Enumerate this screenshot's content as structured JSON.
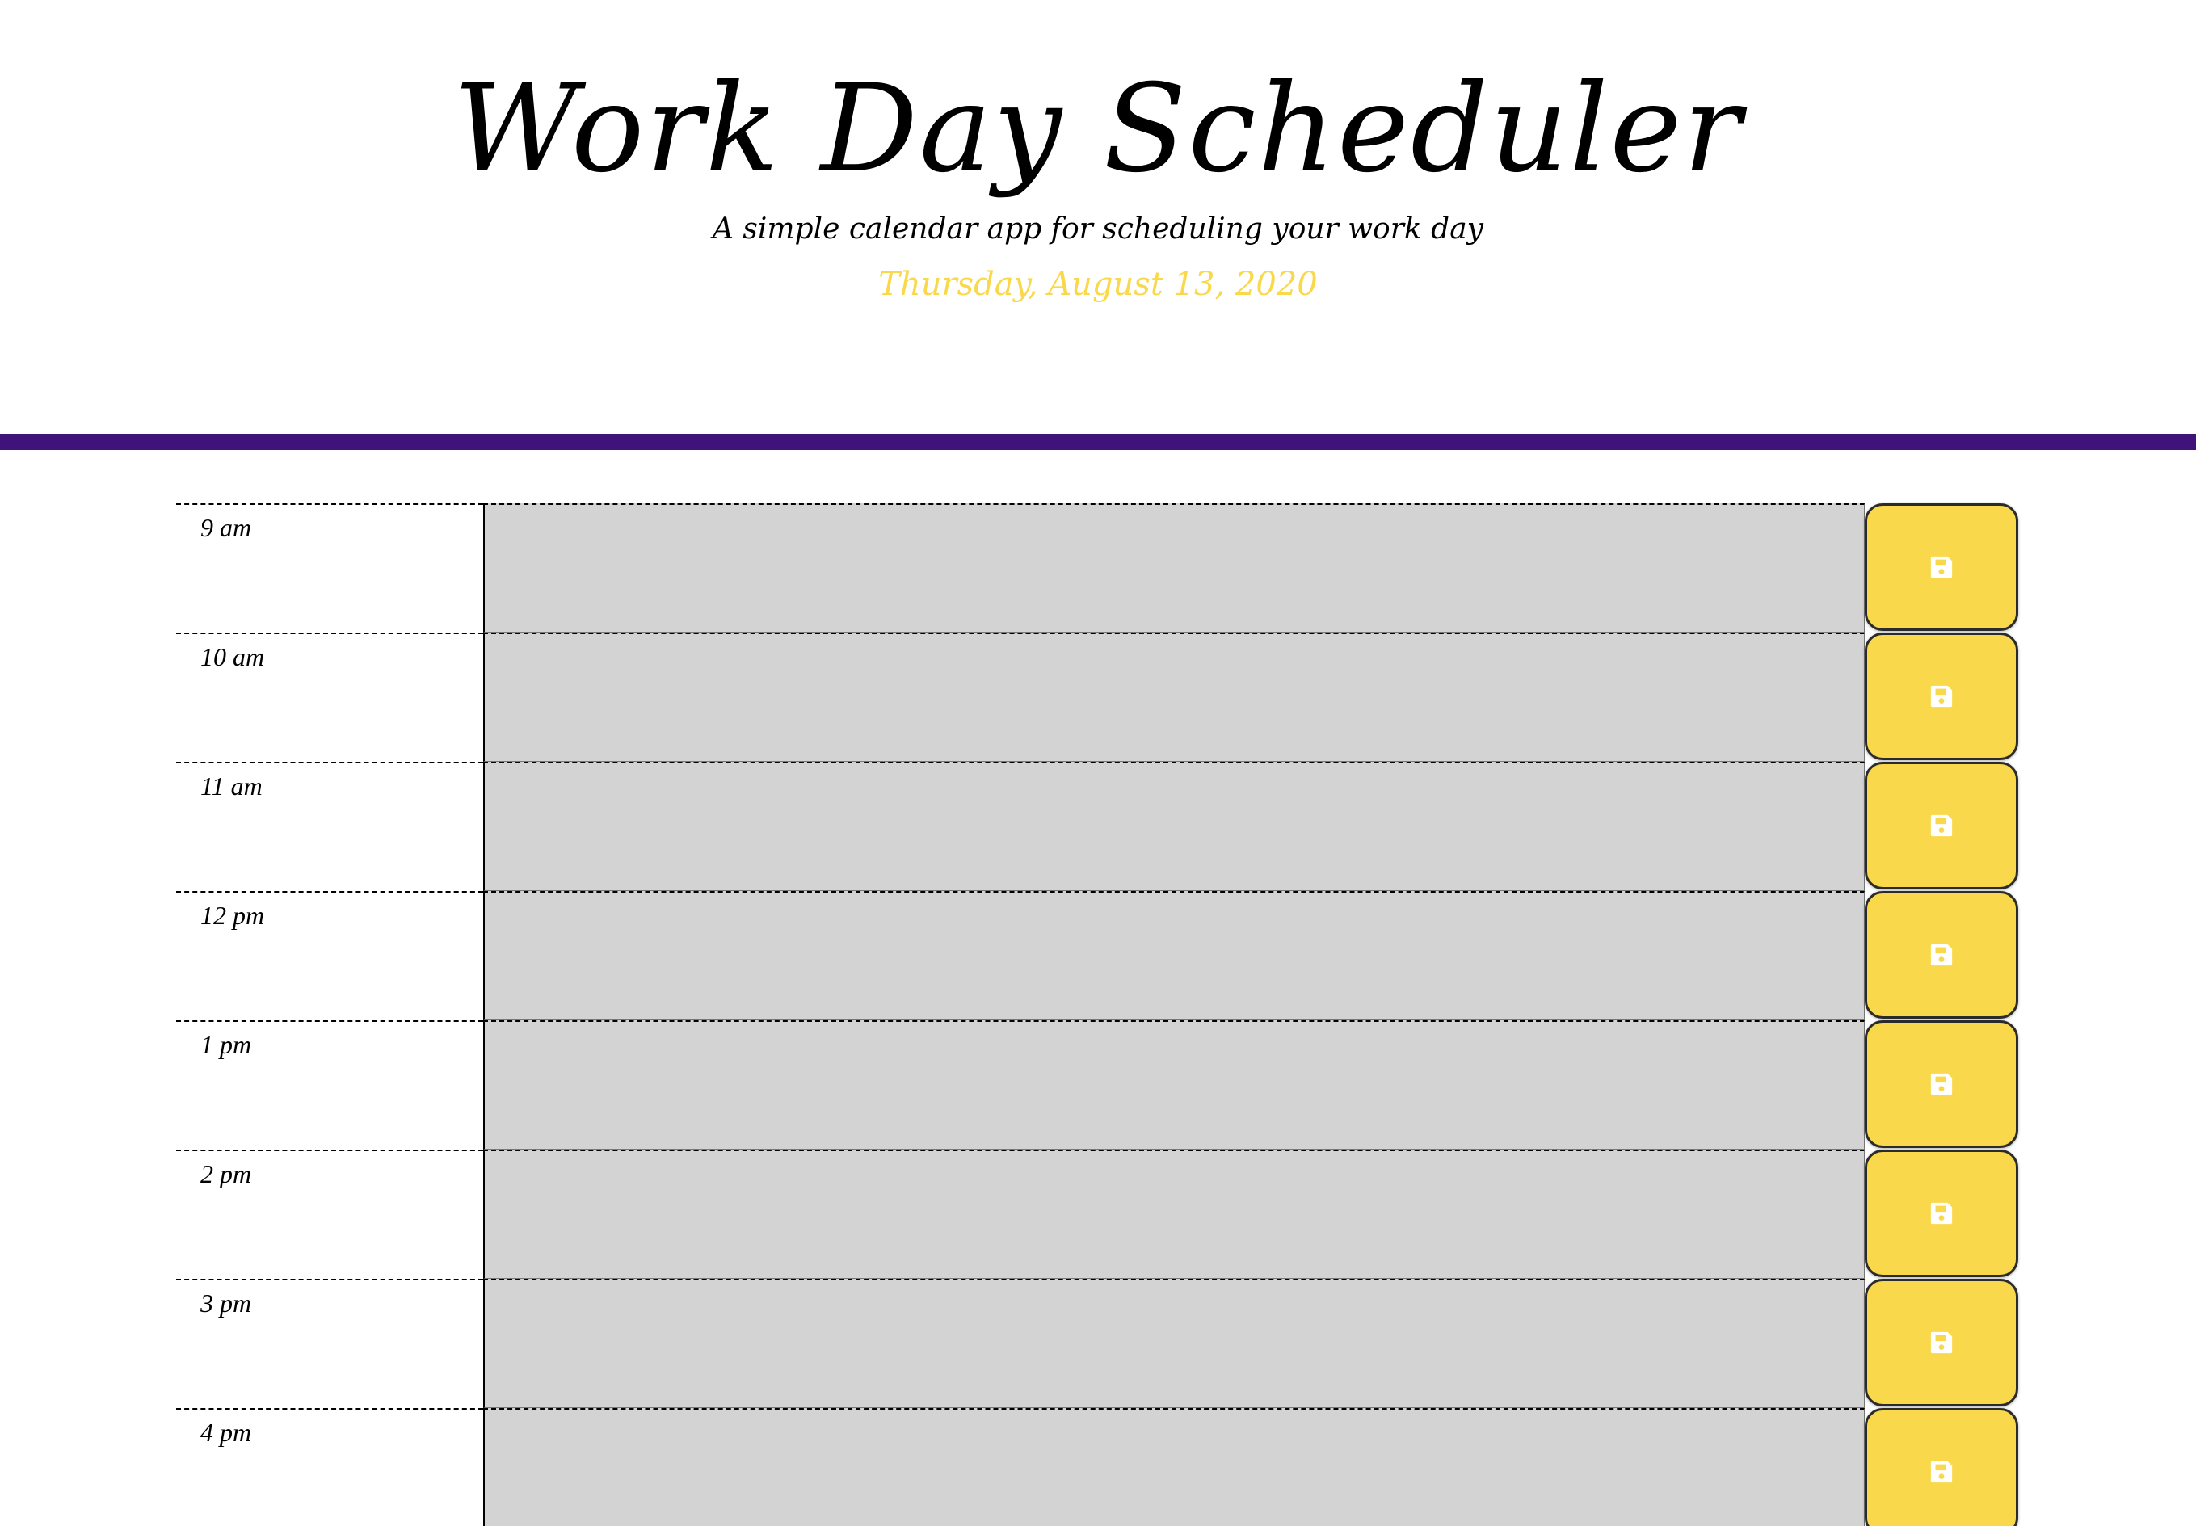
{
  "header": {
    "title": "Work Day Scheduler",
    "subtitle": "A simple calendar app for scheduling your work day",
    "current_day": "Thursday, August 13, 2020"
  },
  "colors": {
    "accent_purple": "#3f137a",
    "save_button_yellow": "#f9d94b",
    "past_block_gray": "#d3d3d3"
  },
  "schedule": {
    "rows": [
      {
        "hour": "9 am",
        "description": "",
        "save_icon": "save-icon"
      },
      {
        "hour": "10 am",
        "description": "",
        "save_icon": "save-icon"
      },
      {
        "hour": "11 am",
        "description": "",
        "save_icon": "save-icon"
      },
      {
        "hour": "12 pm",
        "description": "",
        "save_icon": "save-icon"
      },
      {
        "hour": "1 pm",
        "description": "",
        "save_icon": "save-icon"
      },
      {
        "hour": "2 pm",
        "description": "",
        "save_icon": "save-icon"
      },
      {
        "hour": "3 pm",
        "description": "",
        "save_icon": "save-icon"
      },
      {
        "hour": "4 pm",
        "description": "",
        "save_icon": "save-icon"
      }
    ]
  }
}
